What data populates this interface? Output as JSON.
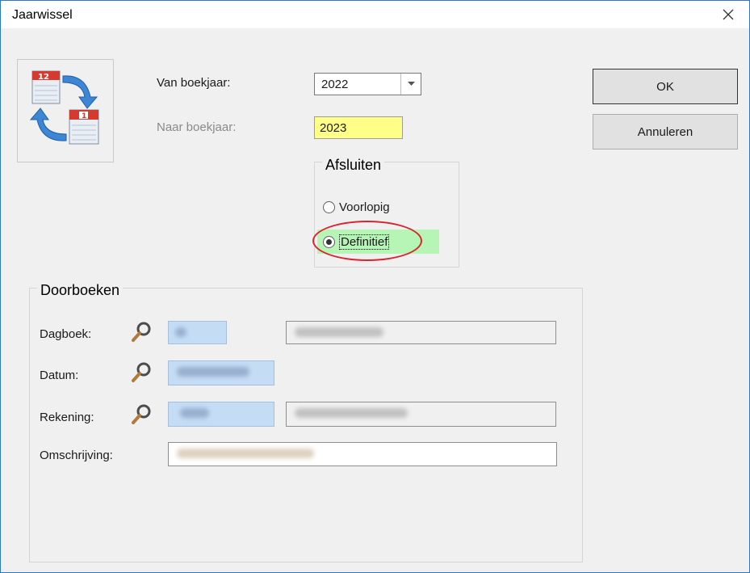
{
  "window": {
    "title": "Jaarwissel"
  },
  "fields": {
    "van_label": "Van boekjaar:",
    "van_value": "2022",
    "naar_label": "Naar boekjaar:",
    "naar_value": "2023"
  },
  "buttons": {
    "ok": "OK",
    "cancel": "Annuleren"
  },
  "afsluiten": {
    "title": "Afsluiten",
    "options": [
      "Voorlopig",
      "Definitief"
    ],
    "selected": "Definitief"
  },
  "doorboeken": {
    "title": "Doorboeken",
    "dagboek_label": "Dagboek:",
    "datum_label": "Datum:",
    "rekening_label": "Rekening:",
    "omschrijving_label": "Omschrijving:"
  },
  "colors": {
    "highlight_yellow": "#ffff88",
    "highlight_green": "#b6f5b6",
    "annotation_red": "#d7262c",
    "lookup_blue": "#c5dcf5"
  },
  "icons": [
    "close-icon",
    "calendar-swap-icon",
    "dropdown-arrow-icon",
    "magnifier-icon"
  ]
}
